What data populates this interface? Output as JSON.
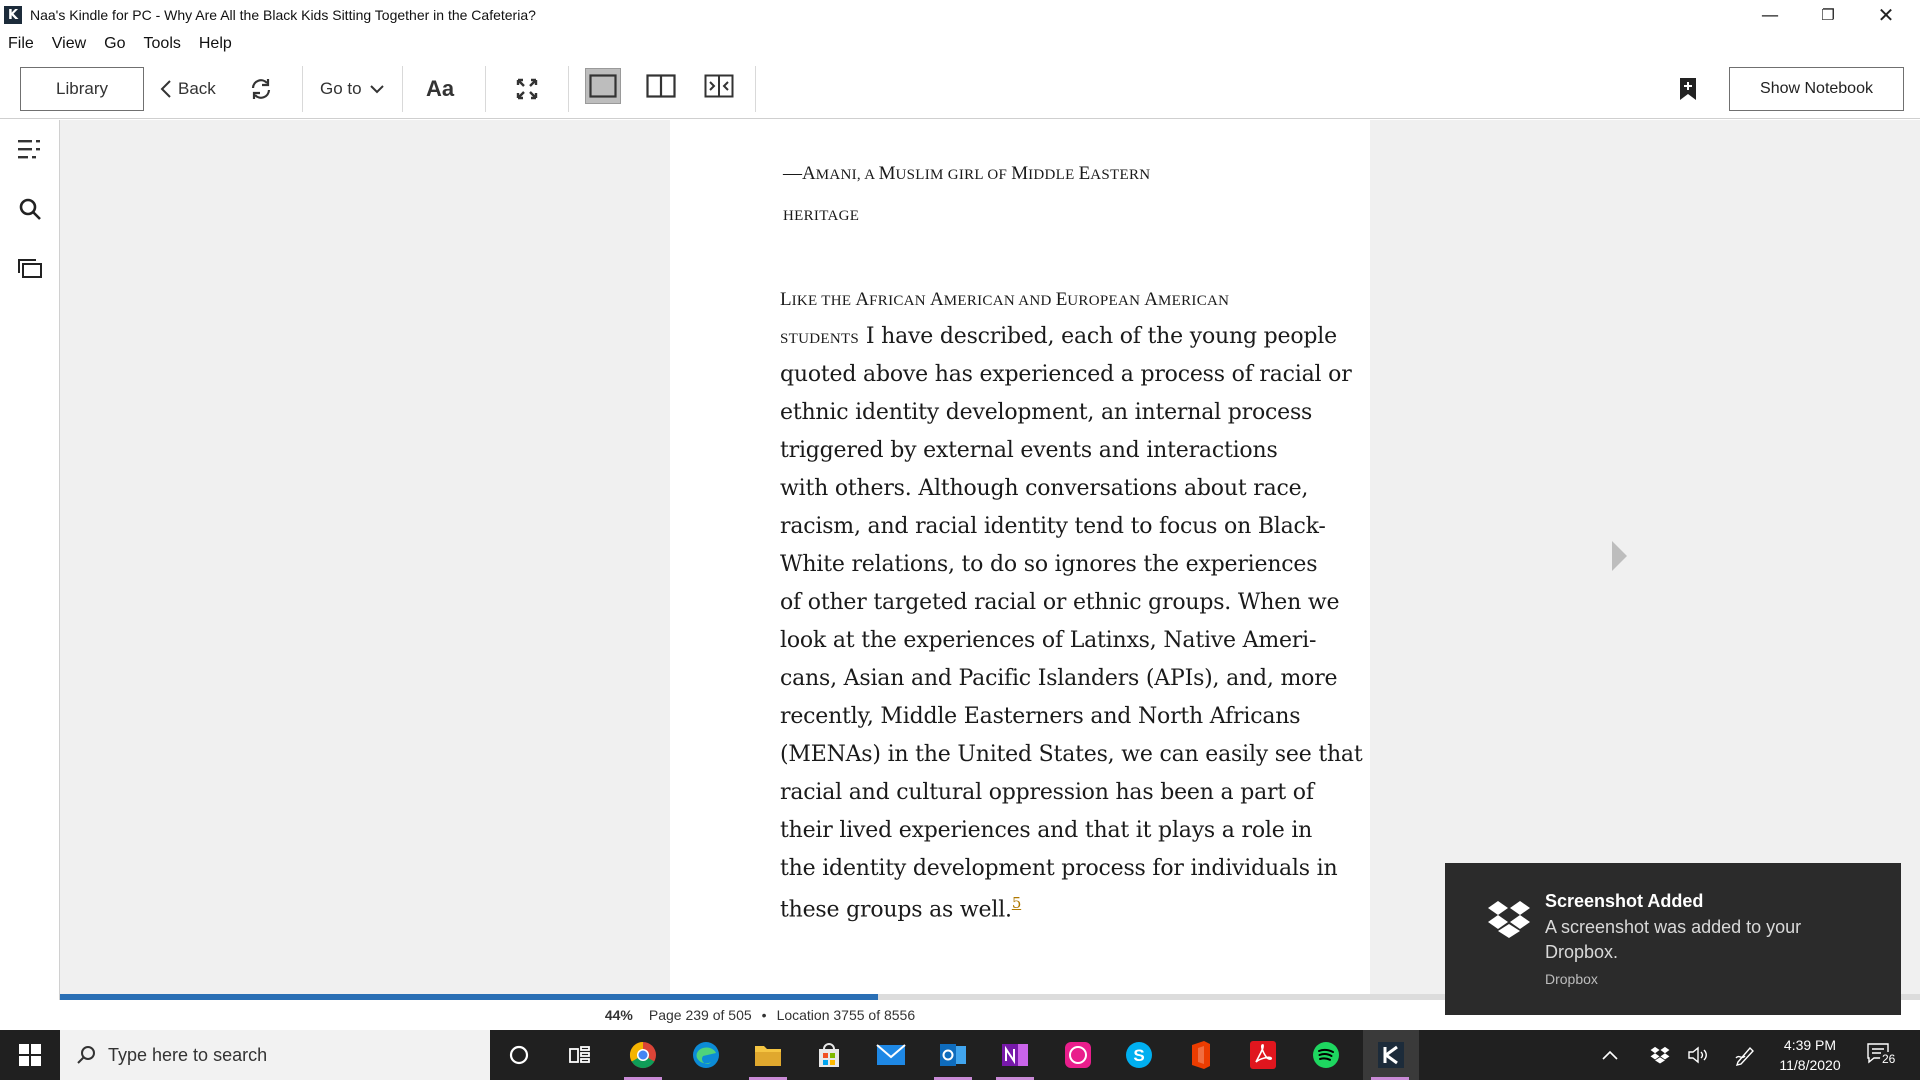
{
  "window": {
    "title": "Naa's Kindle for PC - Why Are All the Black Kids Sitting Together in the Cafeteria?",
    "app_icon_glyph": "K"
  },
  "menu": [
    "File",
    "View",
    "Go",
    "Tools",
    "Help"
  ],
  "toolbar": {
    "library": "Library",
    "back": "Back",
    "goto": "Go to",
    "font": "Aa",
    "show_notebook": "Show Notebook"
  },
  "book": {
    "attribution": {
      "dash": "—",
      "line1_parts": [
        "A",
        "MANI, A ",
        "M",
        "USLIM GIRL OF ",
        "M",
        "IDDLE ",
        "E",
        "ASTERN"
      ],
      "line2": "HERITAGE"
    },
    "lead_in": {
      "line1_parts": [
        "L",
        "IKE THE ",
        "A",
        "FRICAN ",
        "A",
        "MERICAN AND ",
        "E",
        "UROPEAN ",
        "A",
        "MERICAN"
      ],
      "line2_smallcaps": "STUDENTS",
      "line2_rest": " I have described, each of the young people"
    },
    "lines": [
      "quoted above has experienced a process of racial or",
      "ethnic identity development, an internal process",
      "triggered by external events and interactions",
      "with others. Although conversations about race,",
      "racism, and racial identity tend to focus on Black-",
      "White relations, to do so ignores the experiences",
      "of other targeted racial or ethnic groups. When we",
      "look at the experiences of Latinxs, Native Ameri-",
      "cans, Asian and Pacific Islanders (APIs), and, more",
      "recently, Middle Easterners and North Africans",
      "(MENAs) in the United States, we can easily see that",
      "racial and cultural oppression has been a part of",
      "their lived experiences and that it plays a role in",
      "the identity development process for individuals in"
    ],
    "last_line": "these groups as well.",
    "footnote": "5"
  },
  "progress": {
    "fraction": 0.44,
    "percent_label": "44%",
    "page": "Page 239 of 505",
    "separator": "•",
    "location": "Location 3755 of 8556"
  },
  "toast": {
    "title": "Screenshot Added",
    "message": "A screenshot was added to your Dropbox.",
    "source": "Dropbox"
  },
  "taskbar": {
    "search_placeholder": "Type here to search",
    "apps": [
      "cortana-icon",
      "task-view-icon",
      "chrome-icon",
      "edge-icon",
      "file-explorer-icon",
      "store-icon",
      "mail-icon",
      "outlook-icon",
      "onenote-icon",
      "whatsapp-icon",
      "skype-icon",
      "office-icon",
      "acrobat-icon",
      "spotify-icon",
      "kindle-icon"
    ],
    "time": "4:39 PM",
    "date": "11/8/2020",
    "notifications": "26"
  },
  "colors": {
    "progress_fill": "#2a6fb5",
    "footnote": "#b07800",
    "toast_bg": "#2b2b2b",
    "taskbar_bg": "#202020"
  }
}
